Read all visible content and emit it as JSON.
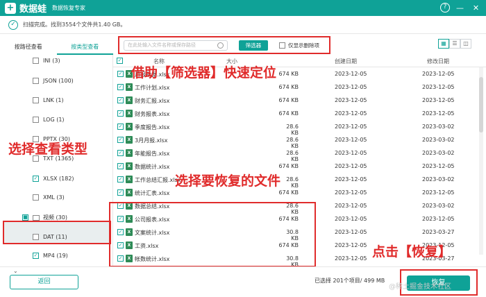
{
  "title": {
    "app": "数据蛙",
    "subtitle": "数据恢复专家",
    "help": "?",
    "minimize": "—",
    "close": "✕"
  },
  "status": {
    "text": "扫描完成。找到3554个文件共1.40 GB。"
  },
  "tabs": [
    "按路径查看",
    "按类型查看"
  ],
  "filter": {
    "search_placeholder": "在此处输入文件名称或保存路径",
    "button": "筛选器",
    "only_deleted": "仅显示删除项"
  },
  "sidebar": {
    "items": [
      {
        "label": "INI (3)",
        "checked": false
      },
      {
        "label": "JSON (100)",
        "checked": false
      },
      {
        "label": "LNK (1)",
        "checked": false
      },
      {
        "label": "LOG (1)",
        "checked": false
      },
      {
        "label": "PPTX (30)",
        "checked": false
      },
      {
        "label": "TXT (1365)",
        "checked": false
      },
      {
        "label": "XLSX (182)",
        "checked": true
      },
      {
        "label": "XML (3)",
        "checked": false
      },
      {
        "label": "视频 (30)",
        "checked": true
      },
      {
        "label": "DAT (11)",
        "checked": false
      },
      {
        "label": "MP4 (19)",
        "checked": true
      }
    ]
  },
  "table": {
    "headers": {
      "name": "名称",
      "size": "大小",
      "created": "创建日期",
      "modified": "修改日期"
    },
    "rows": [
      {
        "name": "月报数据.xlsx",
        "size": "674 KB",
        "created": "2023-12-05",
        "modified": "2023-12-05"
      },
      {
        "name": "工作计划.xlsx",
        "size": "674 KB",
        "created": "2023-12-05",
        "modified": "2023-12-05"
      },
      {
        "name": "财务汇报.xlsx",
        "size": "674 KB",
        "created": "2023-12-05",
        "modified": "2023-12-05"
      },
      {
        "name": "财务报表.xlsx",
        "size": "674 KB",
        "created": "2023-12-05",
        "modified": "2023-12-05"
      },
      {
        "name": "季度报告.xlsx",
        "size": "28.6 KB",
        "created": "2023-12-05",
        "modified": "2023-03-02"
      },
      {
        "name": "3月月报.xlsx",
        "size": "28.6 KB",
        "created": "2023-12-05",
        "modified": "2023-03-02"
      },
      {
        "name": "年能报告.xlsx",
        "size": "28.6 KB",
        "created": "2023-12-05",
        "modified": "2023-03-02"
      },
      {
        "name": "数据统计.xlsx",
        "size": "674 KB",
        "created": "2023-12-05",
        "modified": "2023-12-05"
      },
      {
        "name": "工作总结汇报.xlsx",
        "size": "28.6 KB",
        "created": "2023-12-05",
        "modified": "2023-03-02"
      },
      {
        "name": "统计汇表.xlsx",
        "size": "674 KB",
        "created": "2023-12-05",
        "modified": "2023-12-05"
      },
      {
        "name": "数据总结.xlsx",
        "size": "28.6 KB",
        "created": "2023-12-05",
        "modified": "2023-03-02"
      },
      {
        "name": "公司报表.xlsx",
        "size": "674 KB",
        "created": "2023-12-05",
        "modified": "2023-12-05"
      },
      {
        "name": "文案统计.xlsx",
        "size": "30.8 KB",
        "created": "2023-12-05",
        "modified": "2023-03-27"
      },
      {
        "name": "工资.xlsx",
        "size": "674 KB",
        "created": "2023-12-05",
        "modified": "2023-12-05"
      },
      {
        "name": "帐数统计.xlsx",
        "size": "30.8 KB",
        "created": "2023-12-05",
        "modified": "2023-03-27"
      }
    ]
  },
  "footer": {
    "back": "返回",
    "selection": "已选择 201个项目/ 499 MB",
    "restore": "恢复"
  },
  "annotations": {
    "filter": "借助【筛选器】快速定位",
    "type": "选择查看类型",
    "files": "选择要恢复的文件",
    "restore": "点击【恢复】"
  },
  "watermark": "@稀土掘金技术社区",
  "colors": {
    "accent": "#0fa297",
    "annotation": "#e02b2b"
  }
}
